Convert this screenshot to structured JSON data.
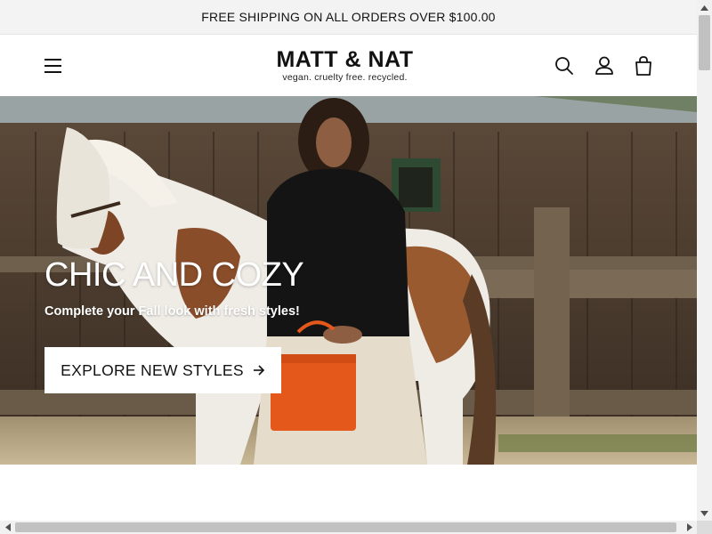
{
  "announcement": {
    "text": "FREE SHIPPING ON ALL ORDERS OVER $100.00"
  },
  "header": {
    "logo_title": "MATT & NAT",
    "logo_tagline": "vegan. cruelty free. recycled.",
    "icons": [
      "menu-icon",
      "search-icon",
      "account-icon",
      "cart-icon"
    ]
  },
  "hero": {
    "title": "CHIC AND COZY",
    "subtitle": "Complete your Fall look with fresh styles!",
    "button_label": "EXPLORE NEW STYLES",
    "button_icon": "arrow-right-icon"
  },
  "colors": {
    "announcement_bg": "#f3f3f3",
    "text": "#121212",
    "button_bg": "#ffffff",
    "bag_orange": "#e5581c"
  }
}
